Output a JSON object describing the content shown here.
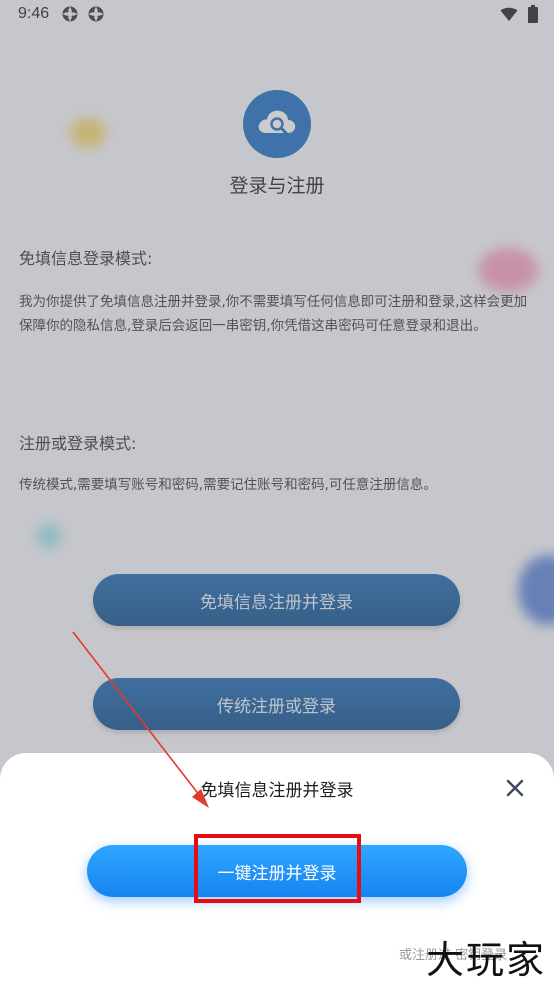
{
  "status_bar": {
    "time": "9:46"
  },
  "app": {
    "title": "登录与注册"
  },
  "sections": [
    {
      "heading": "免填信息登录模式:",
      "body": "我为你提供了免填信息注册并登录,你不需要填写任何信息即可注册和登录,这样会更加保障你的隐私信息,登录后会返回一串密钥,你凭借这串密码可任意登录和退出。"
    },
    {
      "heading": "注册或登录模式:",
      "body": "传统模式,需要填写账号和密码,需要记住账号和密码,可任意注册信息。"
    }
  ],
  "buttons": {
    "free_register": "免填信息注册并登录",
    "traditional": "传统注册或登录"
  },
  "sheet": {
    "title": "免填信息注册并登录",
    "primary_button": "一键注册并登录"
  },
  "watermark": {
    "main": "大玩家",
    "sub": "或注册过 密钥登录"
  },
  "colors": {
    "primary_blue": "#1684f2",
    "dark_button": "#0f4f8c",
    "highlight_red": "#e60c12"
  },
  "icons": {
    "logo": "cloud-search-icon",
    "close": "close-icon",
    "wifi": "wifi-icon",
    "battery": "battery-icon"
  }
}
